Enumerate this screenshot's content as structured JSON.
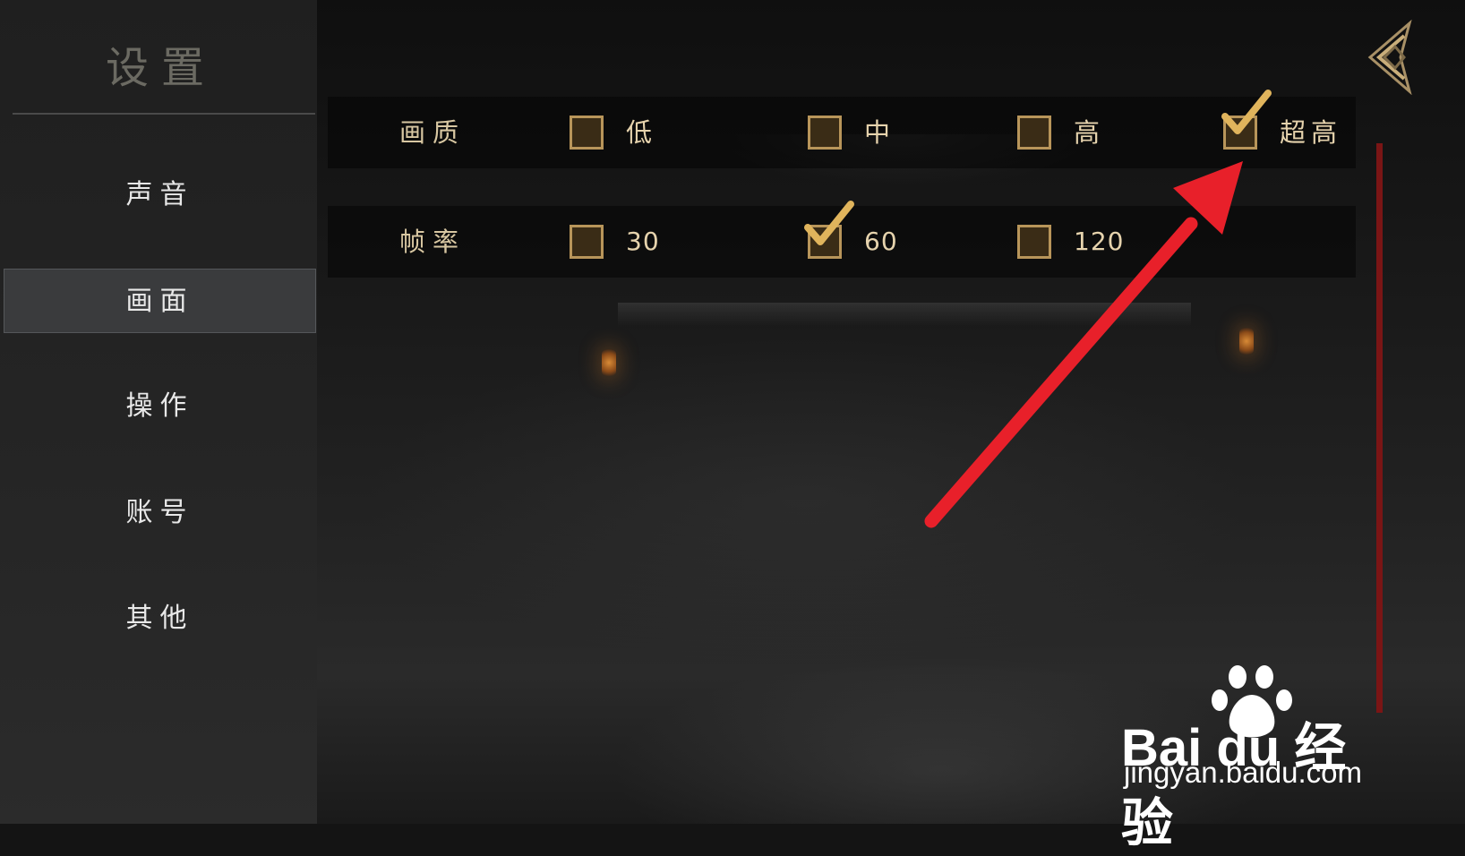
{
  "sidebar": {
    "title": "设置",
    "items": [
      {
        "label": "声音",
        "active": false
      },
      {
        "label": "画面",
        "active": true
      },
      {
        "label": "操作",
        "active": false
      },
      {
        "label": "账号",
        "active": false
      },
      {
        "label": "其他",
        "active": false
      }
    ]
  },
  "settings": {
    "quality": {
      "label": "画质",
      "options": [
        {
          "label": "低",
          "checked": false
        },
        {
          "label": "中",
          "checked": false
        },
        {
          "label": "高",
          "checked": false
        },
        {
          "label": "超高",
          "checked": true
        }
      ]
    },
    "framerate": {
      "label": "帧率",
      "options": [
        {
          "label": "30",
          "checked": false
        },
        {
          "label": "60",
          "checked": true
        },
        {
          "label": "120",
          "checked": false
        }
      ]
    }
  },
  "colors": {
    "accent_gold": "#b8955a",
    "label_gold": "#d8c7a2",
    "scrollbar_red": "#7a1515",
    "annotation_arrow": "#e8202a"
  },
  "icons": {
    "back": "back-diamond-icon",
    "check": "checkmark-icon"
  },
  "watermark": {
    "brand": "Bai du 经验",
    "url": "jingyan.baidu.com"
  }
}
